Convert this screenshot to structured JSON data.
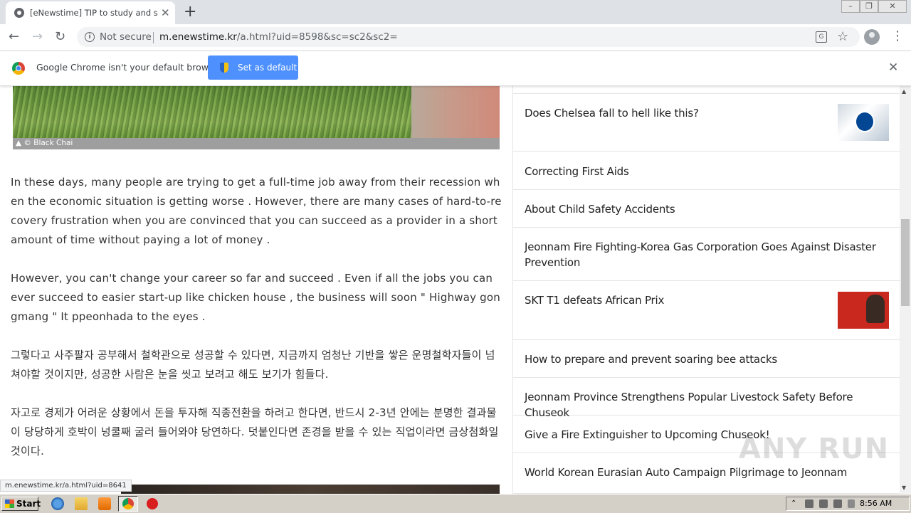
{
  "browser": {
    "tab_title": "[eNewstime] TIP to study and succeed",
    "tab_close": "✕",
    "new_tab": "+",
    "window_controls": [
      "–",
      "❐",
      "✕"
    ],
    "security_label": "Not secure",
    "url_host": "m.enewstime.kr",
    "url_path": "/a.html?uid=8598&sc=sc2&sc2=",
    "status_url": "m.enewstime.kr/a.html?uid=8641"
  },
  "infobar": {
    "message": "Google Chrome isn't your default browser",
    "button_label": "Set as default",
    "close": "✕"
  },
  "photo": {
    "caption": "▲ © Black Chai"
  },
  "article": {
    "paragraphs": [
      "In these days, many people are trying to get a full-time job away from their recession when the economic situation is getting worse . However, there are many cases of hard-to-recovery frustration when you are convinced that you can succeed as a provider in a short amount of time without paying a lot of money .",
      "However, you can't change your career so far and succeed . Even if all the jobs you can ever succeed to easier start-up like chicken house , the business will soon \" Highway gongmang \" It ppeonhada to the eyes .",
      "그렇다고 사주팔자 공부해서 철학관으로 성공할 수 있다면, 지금까지 엄청난 기반을 쌓은 운명철학자들이 넘쳐야할 것이지만, 성공한 사람은 눈을 씻고 보려고 해도 보기가 힘들다.",
      "자고로 경제가 어려운 상황에서 돈을 투자해 직종전환을 하려고 한다면, 반드시 2-3년 안에는 분명한 결과물이 당당하게 호박이 넝쿨째 굴러 들어와야 당연하다. 덧붙인다면 존경을 받을 수 있는 직업이라면 금상첨화일 것이다."
    ]
  },
  "sidebar": {
    "items": [
      {
        "title": "Does Chelsea fall to hell like this?",
        "thumb": "chelsea-crest"
      },
      {
        "title": "Correcting First Aids"
      },
      {
        "title": "About Child Safety Accidents"
      },
      {
        "title": "Jeonnam Fire Fighting-Korea Gas Corporation Goes Against Disaster Prevention"
      },
      {
        "title": "SKT T1 defeats African Prix",
        "thumb": "wild-card"
      },
      {
        "title": "How to prepare and prevent soaring bee attacks"
      },
      {
        "title": "Jeonnam Province Strengthens Popular Livestock Safety Before Chuseok"
      },
      {
        "title": "Give a Fire Extinguisher to Upcoming Chuseok!"
      },
      {
        "title": "World Korean Eurasian Auto Campaign Pilgrimage to Jeonnam"
      }
    ]
  },
  "watermark": "ANY RUN",
  "taskbar": {
    "start_label": "Start",
    "clock": "8:56 AM"
  }
}
